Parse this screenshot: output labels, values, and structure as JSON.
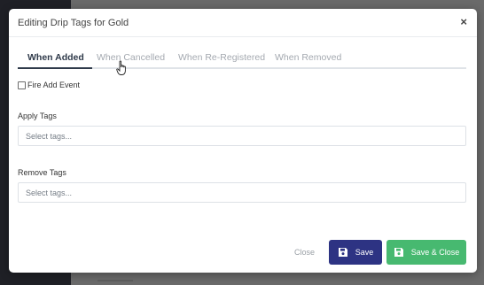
{
  "modal": {
    "title": "Editing Drip Tags for Gold",
    "close_icon": "×"
  },
  "tabs": [
    {
      "label": "When Added",
      "active": true
    },
    {
      "label": "When Cancelled",
      "active": false
    },
    {
      "label": "When Re-Registered",
      "active": false
    },
    {
      "label": "When Removed",
      "active": false
    }
  ],
  "fire_add_event": {
    "label": "Fire Add Event",
    "checked": false
  },
  "apply_tags": {
    "label": "Apply Tags",
    "placeholder": "Select tags..."
  },
  "remove_tags": {
    "label": "Remove Tags",
    "placeholder": "Select tags..."
  },
  "footer": {
    "close_label": "Close",
    "save_label": "Save",
    "save_close_label": "Save & Close"
  },
  "colors": {
    "save_button": "#2d3383",
    "save_close_button": "#47b970",
    "active_tab": "#2f3a4a",
    "inactive_tab": "#a4a9b0"
  }
}
